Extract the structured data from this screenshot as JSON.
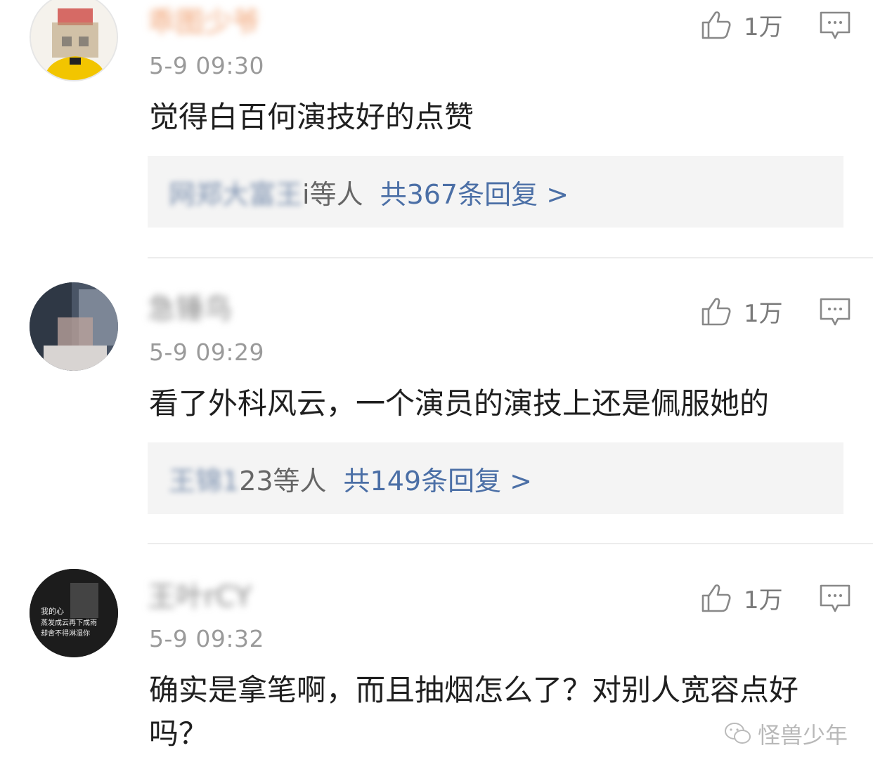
{
  "comments": [
    {
      "username": "乖图少爷",
      "time": "5-9 09:30",
      "text": "觉得白百何演技好的点赞",
      "likes": "1万",
      "replies": {
        "names": "网郑大富王",
        "suffix": "i等人",
        "link": "共367条回复 >"
      }
    },
    {
      "username": "急锤鸟",
      "time": "5-9 09:29",
      "text": "看了外科风云，一个演员的演技上还是佩服她的",
      "likes": "1万",
      "replies": {
        "names": "王锦1",
        "suffix": "23等人",
        "link": "共149条回复 >"
      }
    },
    {
      "username": "王叶rCY",
      "time": "5-9 09:32",
      "text": "确实是拿笔啊，而且抽烟怎么了？对别人宽容点好吗？",
      "likes": "1万"
    }
  ],
  "avatar3_text": [
    "我的心",
    "蒸发成云再下成雨",
    "却舍不得淋湿你"
  ],
  "watermark": {
    "icon": "wechat-icon",
    "label": "怪兽少年"
  },
  "colors": {
    "reply_link": "#4b6fa6",
    "reply_bg": "#f4f4f4",
    "muted": "#9a9a9a"
  }
}
